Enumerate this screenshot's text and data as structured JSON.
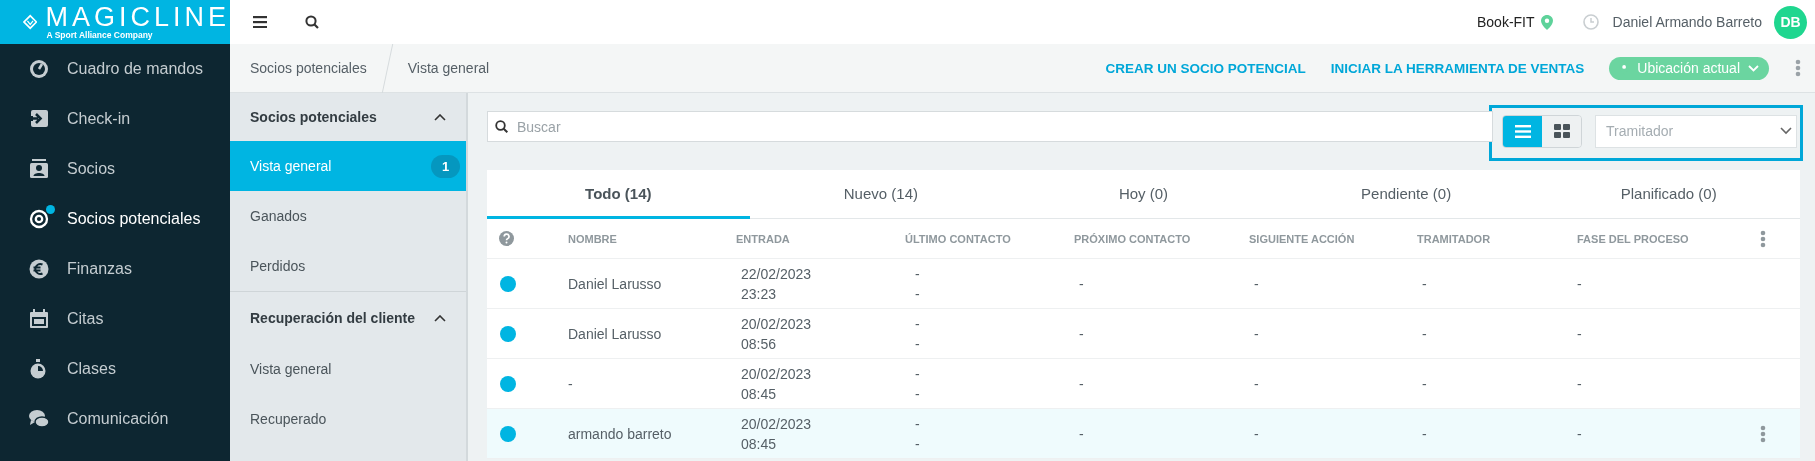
{
  "brand": {
    "name": "MAGICLINE",
    "tagline": "A Sport Alliance Company"
  },
  "nav": {
    "items": [
      {
        "label": "Cuadro de mandos",
        "selected": false,
        "notification": false
      },
      {
        "label": "Check-in",
        "selected": false,
        "notification": false
      },
      {
        "label": "Socios",
        "selected": false,
        "notification": false
      },
      {
        "label": "Socios potenciales",
        "selected": true,
        "notification": true
      },
      {
        "label": "Finanzas",
        "selected": false,
        "notification": false
      },
      {
        "label": "Citas",
        "selected": false,
        "notification": false
      },
      {
        "label": "Clases",
        "selected": false,
        "notification": false
      },
      {
        "label": "Comunicación",
        "selected": false,
        "notification": false
      }
    ]
  },
  "topbar": {
    "location": "Book-FIT",
    "user": "Daniel Armando Barreto",
    "avatar": "DB"
  },
  "breadcrumb": [
    "Socios potenciales",
    "Vista general"
  ],
  "actions": [
    "CREAR UN SOCIO POTENCIAL",
    "INICIAR LA HERRAMIENTA DE VENTAS"
  ],
  "location_button": {
    "label": "Ubicación actual"
  },
  "subnav": {
    "groups": [
      {
        "title": "Socios potenciales",
        "expanded": true,
        "items": [
          {
            "label": "Vista general",
            "selected": true,
            "badge": "1"
          },
          {
            "label": "Ganados",
            "selected": false
          },
          {
            "label": "Perdidos",
            "selected": false
          }
        ]
      },
      {
        "title": "Recuperación del cliente",
        "expanded": true,
        "items": [
          {
            "label": "Vista general",
            "selected": false
          },
          {
            "label": "Recuperado",
            "selected": false
          }
        ]
      }
    ]
  },
  "search": {
    "placeholder": "Buscar"
  },
  "view_toggle": [
    {
      "kind": "list",
      "selected": true
    },
    {
      "kind": "grid",
      "selected": false
    }
  ],
  "assignee_select": {
    "placeholder": "Tramitador"
  },
  "tabs": [
    {
      "label": "Todo (14)",
      "selected": true
    },
    {
      "label": "Nuevo (14)",
      "selected": false
    },
    {
      "label": "Hoy (0)",
      "selected": false
    },
    {
      "label": "Pendiente (0)",
      "selected": false
    },
    {
      "label": "Planificado (0)",
      "selected": false
    }
  ],
  "table": {
    "columns": [
      "NOMBRE",
      "ENTRADA",
      "ÚLTIMO CONTACTO",
      "PRÓXIMO CONTACTO",
      "SIGUIENTE ACCIÓN",
      "TRAMITADOR",
      "FASE DEL PROCESO"
    ],
    "rows": [
      {
        "name": "Daniel Larusso",
        "entry_date": "22/02/2023",
        "entry_time": "23:23",
        "last_contact": [
          "-",
          "-"
        ],
        "next_contact": "-",
        "next_action": "-",
        "assignee": "-",
        "phase": "-",
        "hovered": false
      },
      {
        "name": "Daniel Larusso",
        "entry_date": "20/02/2023",
        "entry_time": "08:56",
        "last_contact": [
          "-",
          "-"
        ],
        "next_contact": "-",
        "next_action": "-",
        "assignee": "-",
        "phase": "-",
        "hovered": false
      },
      {
        "name": "-",
        "entry_date": "20/02/2023",
        "entry_time": "08:45",
        "last_contact": [
          "-",
          "-"
        ],
        "next_contact": "-",
        "next_action": "-",
        "assignee": "-",
        "phase": "-",
        "hovered": false
      },
      {
        "name": "armando barreto",
        "entry_date": "20/02/2023",
        "entry_time": "08:45",
        "last_contact": [
          "-",
          "-"
        ],
        "next_contact": "-",
        "next_action": "-",
        "assignee": "-",
        "phase": "-",
        "hovered": true
      }
    ]
  }
}
